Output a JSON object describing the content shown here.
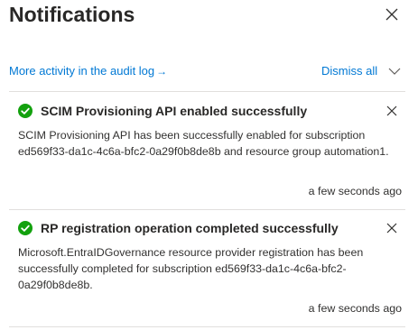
{
  "panel": {
    "title": "Notifications",
    "close_icon": "close-icon"
  },
  "actions": {
    "audit_link_label": "More activity in the audit log",
    "audit_link_arrow": "→",
    "dismiss_all_label": "Dismiss all",
    "dismiss_chevron_icon": "chevron-down-icon"
  },
  "notifications": [
    {
      "status": "success",
      "icon": "check-circle-icon",
      "title": "SCIM Provisioning API enabled successfully",
      "description": "SCIM Provisioning API has been successfully enabled for subscription ed569f33-da1c-4c6a-bfc2-0a29f0b8de8b and resource group automation1.",
      "time": "a few seconds ago"
    },
    {
      "status": "success",
      "icon": "check-circle-icon",
      "title": "RP registration operation completed successfully",
      "description": "Microsoft.EntraIDGovernance resource provider registration has been successfully completed for subscription ed569f33-da1c-4c6a-bfc2-0a29f0b8de8b.",
      "time": "a few seconds ago"
    }
  ],
  "colors": {
    "link": "#0078d4",
    "success": "#13a10e",
    "divider": "#e1dfdd",
    "text": "#323130"
  }
}
